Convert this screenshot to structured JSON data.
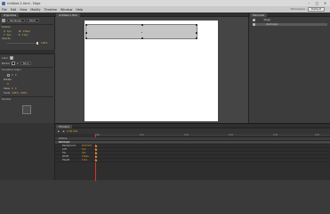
{
  "window": {
    "title": "Untitled-1.html - Edge",
    "buttons": [
      "–",
      "□",
      "×"
    ]
  },
  "menu": [
    "File",
    "Edit",
    "View",
    "Modify",
    "Timeline",
    "Window",
    "Help"
  ],
  "workspace": {
    "label": "Workspace",
    "value": "Default"
  },
  "left_panel": {
    "tab": "Properties",
    "element_name": "Rectangle",
    "display_dd": "Block",
    "position_label": "Position",
    "x_label": "X",
    "x_val": "1px",
    "y_label": "Y",
    "y_val": "4px",
    "w_label": "W",
    "w_val": "126px",
    "h_label": "H",
    "h_val": "17px",
    "opacity_label": "Opacity",
    "opacity_val": "100%",
    "color_label": "Color",
    "border_label": "Border",
    "border_dd": "None",
    "transform_label": "Transform Origin",
    "rotate_label": "Rotate",
    "skew_label": "Skew",
    "scale_label": "Scale",
    "shadow_label": "Shadow",
    "zero": "0",
    "scale_val": "100%",
    "colors": {
      "fill": "#c5c5c5",
      "border": "#000000"
    }
  },
  "stage": {
    "tab": "Untitled-1.html"
  },
  "elements_panel": {
    "tab": "Elements",
    "items": [
      {
        "label": "Stage"
      },
      {
        "label": "Rectangle"
      }
    ]
  },
  "timeline": {
    "tab": "Timeline",
    "time": "0:00.000",
    "ticks": [
      "0:00",
      "0:01",
      "0:02",
      "0:03",
      "0:04",
      "0:05"
    ],
    "rows": [
      {
        "name": "Actions",
        "value": ""
      },
      {
        "name": "Rectangle",
        "value": ""
      },
      {
        "name": "Background",
        "value": "#c5c5c5"
      },
      {
        "name": "Left",
        "value": "1px"
      },
      {
        "name": "Top",
        "value": "4px"
      },
      {
        "name": "Width",
        "value": "126px"
      },
      {
        "name": "Height",
        "value": "17px"
      }
    ]
  }
}
